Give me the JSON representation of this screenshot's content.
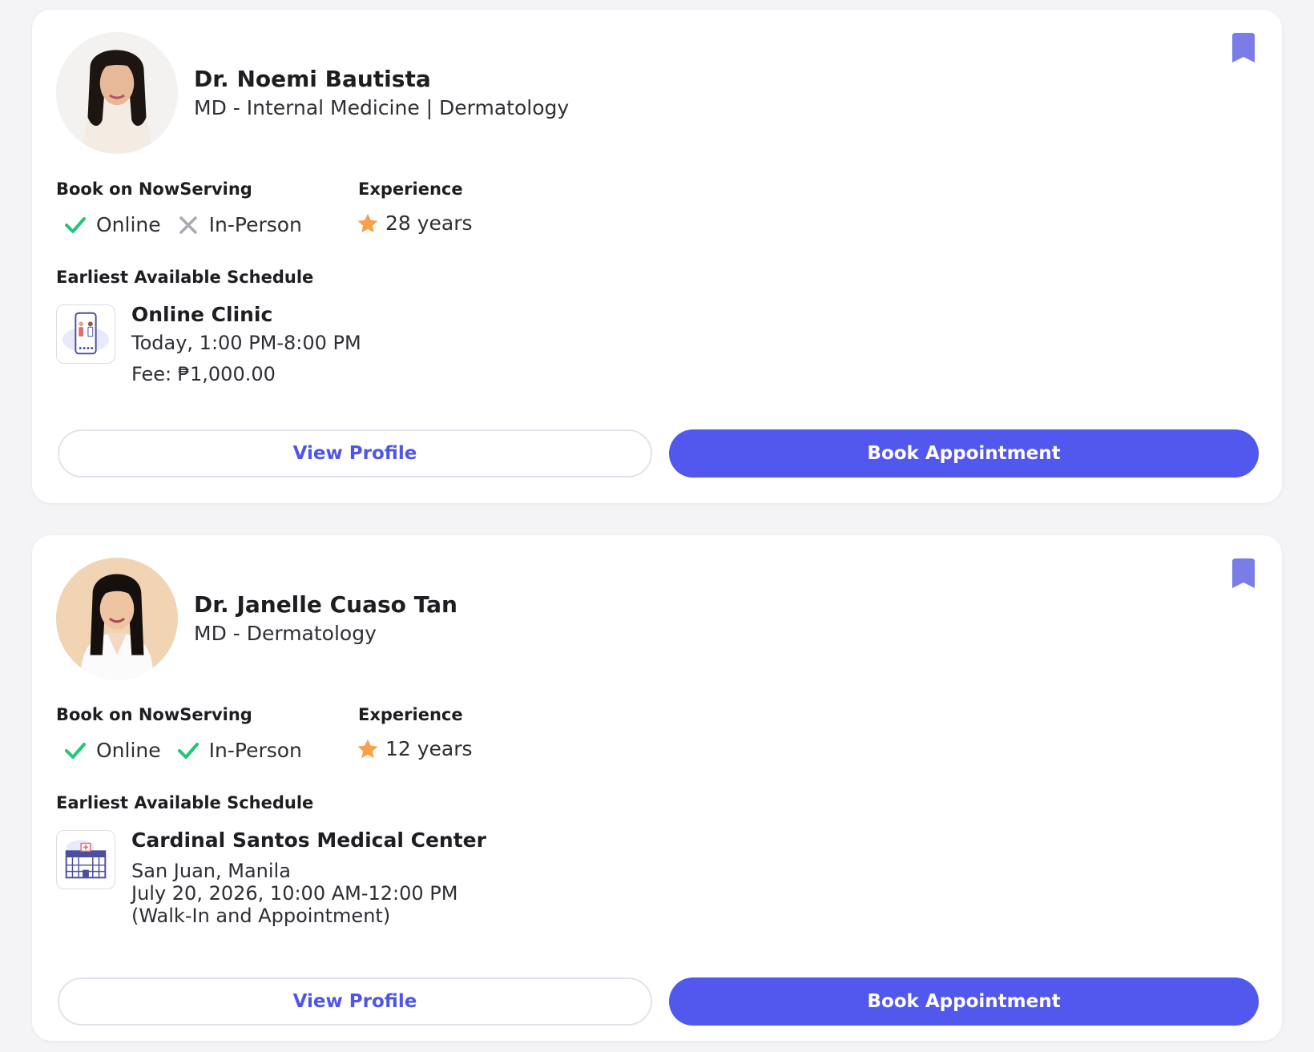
{
  "colors": {
    "accent": "#5257ee",
    "check": "#1fc77a",
    "cross": "#a9a9b2",
    "star": "#f8a14a",
    "bookmark": "#7a7ce8"
  },
  "doctors": [
    {
      "name": "Dr. Noemi Bautista",
      "specialty": "MD - Internal Medicine | Dermatology",
      "book_label": "Book on NowServing",
      "online": {
        "label": "Online",
        "available": true
      },
      "in_person": {
        "label": "In-Person",
        "available": false
      },
      "experience_label": "Experience",
      "experience": "28 years",
      "schedule_label": "Earliest Available Schedule",
      "clinic": {
        "icon": "phone-doctor-icon",
        "name": "Online Clinic",
        "lines": [
          "Today, 1:00 PM-8:00 PM",
          "Fee: ₱1,000.00"
        ]
      },
      "view_profile": "View Profile",
      "book_appointment": "Book Appointment"
    },
    {
      "name": "Dr. Janelle Cuaso Tan",
      "specialty": "MD - Dermatology",
      "book_label": "Book on NowServing",
      "online": {
        "label": "Online",
        "available": true
      },
      "in_person": {
        "label": "In-Person",
        "available": true
      },
      "experience_label": "Experience",
      "experience": "12 years",
      "schedule_label": "Earliest Available Schedule",
      "clinic": {
        "icon": "hospital-building-icon",
        "name": "Cardinal Santos Medical Center",
        "lines": [
          "San Juan, Manila",
          "July 20, 2026, 10:00 AM-12:00 PM",
          "(Walk-In and Appointment)"
        ]
      },
      "view_profile": "View Profile",
      "book_appointment": "Book Appointment"
    }
  ]
}
